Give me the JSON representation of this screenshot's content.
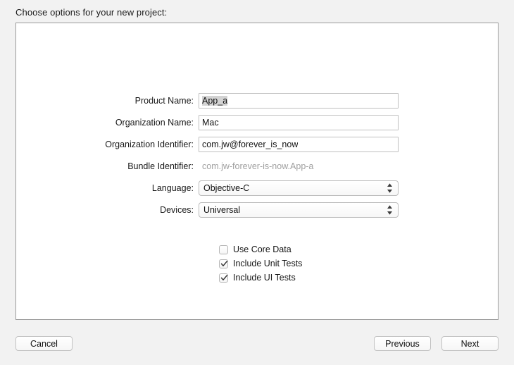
{
  "dialog": {
    "prompt": "Choose options for your new project:"
  },
  "form": {
    "fields": [
      {
        "label": "Product Name:",
        "value": "App_a",
        "type": "text"
      },
      {
        "label": "Organization Name:",
        "value": "Mac",
        "type": "text"
      },
      {
        "label": "Organization Identifier:",
        "value": "com.jw@forever_is_now",
        "type": "text"
      },
      {
        "label": "Bundle Identifier:",
        "value": "com.jw-forever-is-now.App-a",
        "type": "static"
      },
      {
        "label": "Language:",
        "value": "Objective-C",
        "type": "popup"
      },
      {
        "label": "Devices:",
        "value": "Universal",
        "type": "popup"
      }
    ]
  },
  "options": [
    {
      "label": "Use Core Data",
      "checked": false
    },
    {
      "label": "Include Unit Tests",
      "checked": true
    },
    {
      "label": "Include UI Tests",
      "checked": true
    }
  ],
  "buttons": {
    "cancel": "Cancel",
    "previous": "Previous",
    "next": "Next"
  },
  "colors": {
    "window_background": "#f2f2f2",
    "panel_background": "#ffffff",
    "panel_border": "#9a9a9a",
    "field_border": "#bfbfbf",
    "selection_highlight": "#d3d3d3",
    "static_text": "#a0a0a0",
    "text": "#1a1a1a"
  },
  "icons": {
    "stepper": "chevron-up-down-icon",
    "checkmark": "checkmark-icon"
  }
}
